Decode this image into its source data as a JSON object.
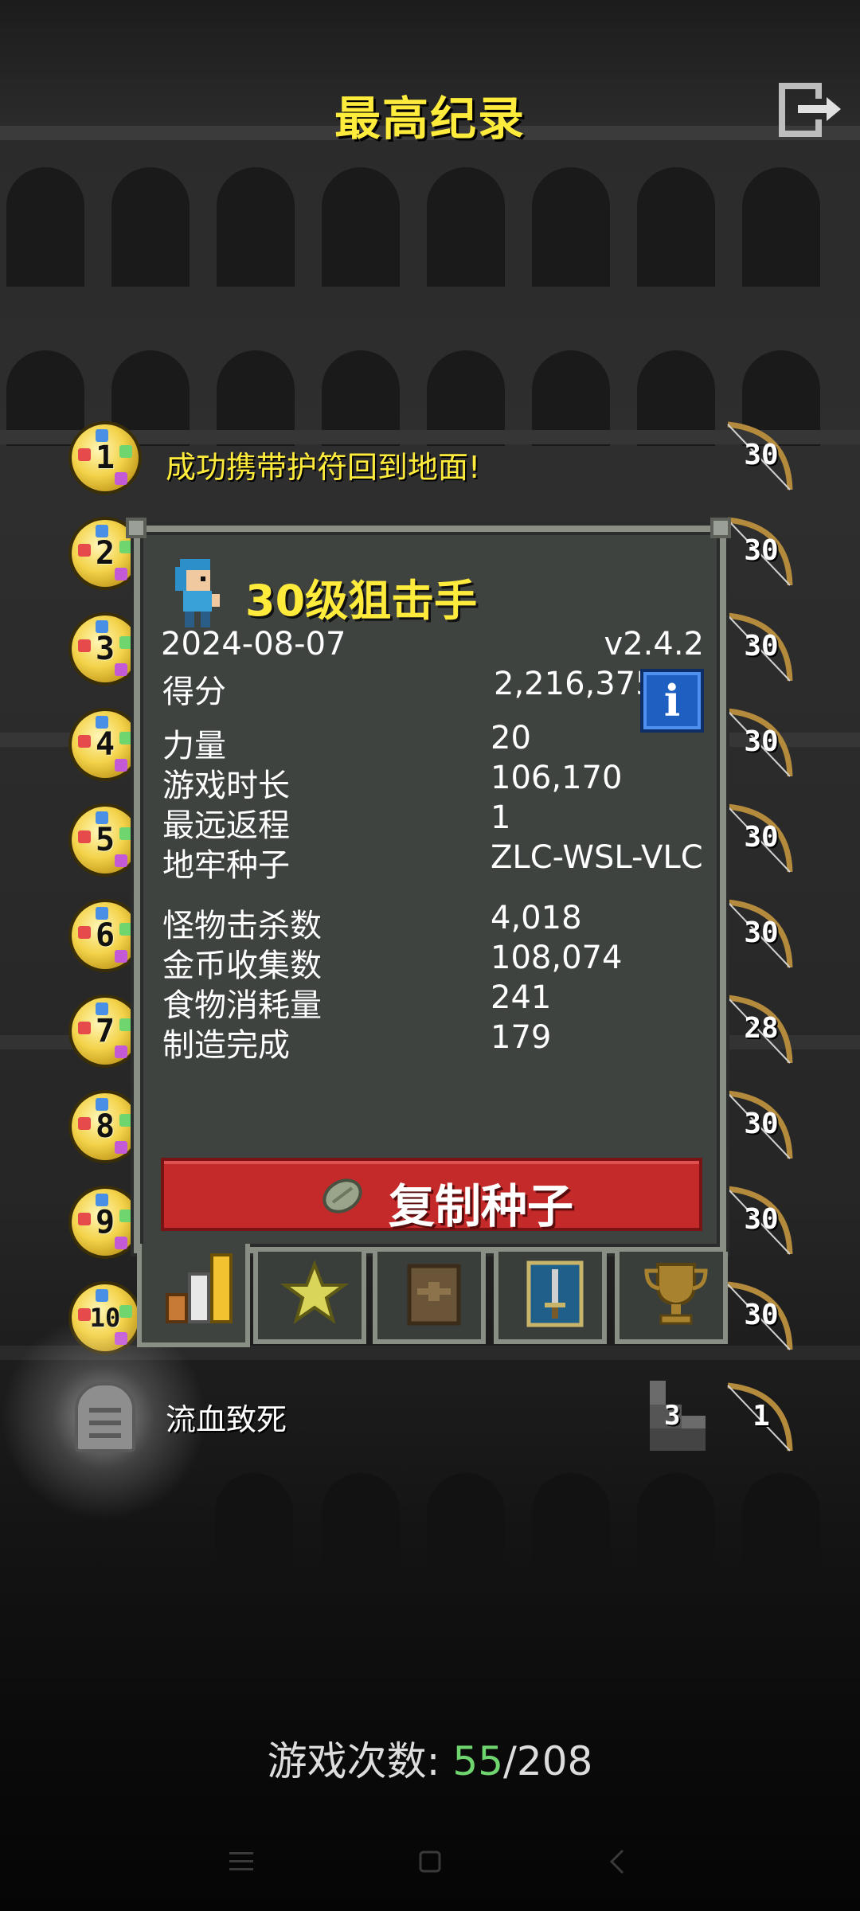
{
  "header": {
    "title": "最高纪录",
    "exit_icon": "exit-icon"
  },
  "rankings": [
    {
      "rank": "1",
      "text": "成功携带护符回到地面!",
      "level": "30"
    },
    {
      "rank": "2",
      "level": "30"
    },
    {
      "rank": "3",
      "level": "30"
    },
    {
      "rank": "4",
      "level": "30"
    },
    {
      "rank": "5",
      "level": "30"
    },
    {
      "rank": "6",
      "level": "30"
    },
    {
      "rank": "7",
      "level": "28"
    },
    {
      "rank": "8",
      "level": "30"
    },
    {
      "rank": "9",
      "level": "30"
    },
    {
      "rank": "10",
      "level": "30"
    }
  ],
  "latest": {
    "text": "流血致死",
    "depth": "3",
    "level": "1"
  },
  "detail": {
    "hero_title": "30级狙击手",
    "date": "2024-08-07",
    "version": "v2.4.2",
    "stats": [
      {
        "label": "得分",
        "value": "2,216,375"
      },
      {
        "label": "力量",
        "value": "20"
      },
      {
        "label": "游戏时长",
        "value": "106,170"
      },
      {
        "label": "最远返程",
        "value": "1"
      },
      {
        "label": "地牢种子",
        "value": "ZLC-WSL-VLC"
      },
      {
        "label": "怪物击杀数",
        "value": "4,018"
      },
      {
        "label": "金币收集数",
        "value": "108,074"
      },
      {
        "label": "食物消耗量",
        "value": "241"
      },
      {
        "label": "制造完成",
        "value": "179"
      }
    ],
    "info_label": "i",
    "copy_seed_label": "复制种子"
  },
  "tabs": [
    "stats-tab",
    "badges-tab",
    "items-tab",
    "talents-tab",
    "challenges-tab"
  ],
  "footer": {
    "games_label": "游戏次数:",
    "games_won": "55",
    "games_total": "/208"
  },
  "colors": {
    "title": "#ffeb3b",
    "panel": "#3e4340",
    "copy_button": "#c52a2a",
    "info_button": "#1e5fc2",
    "games_won": "#6fd66f"
  }
}
